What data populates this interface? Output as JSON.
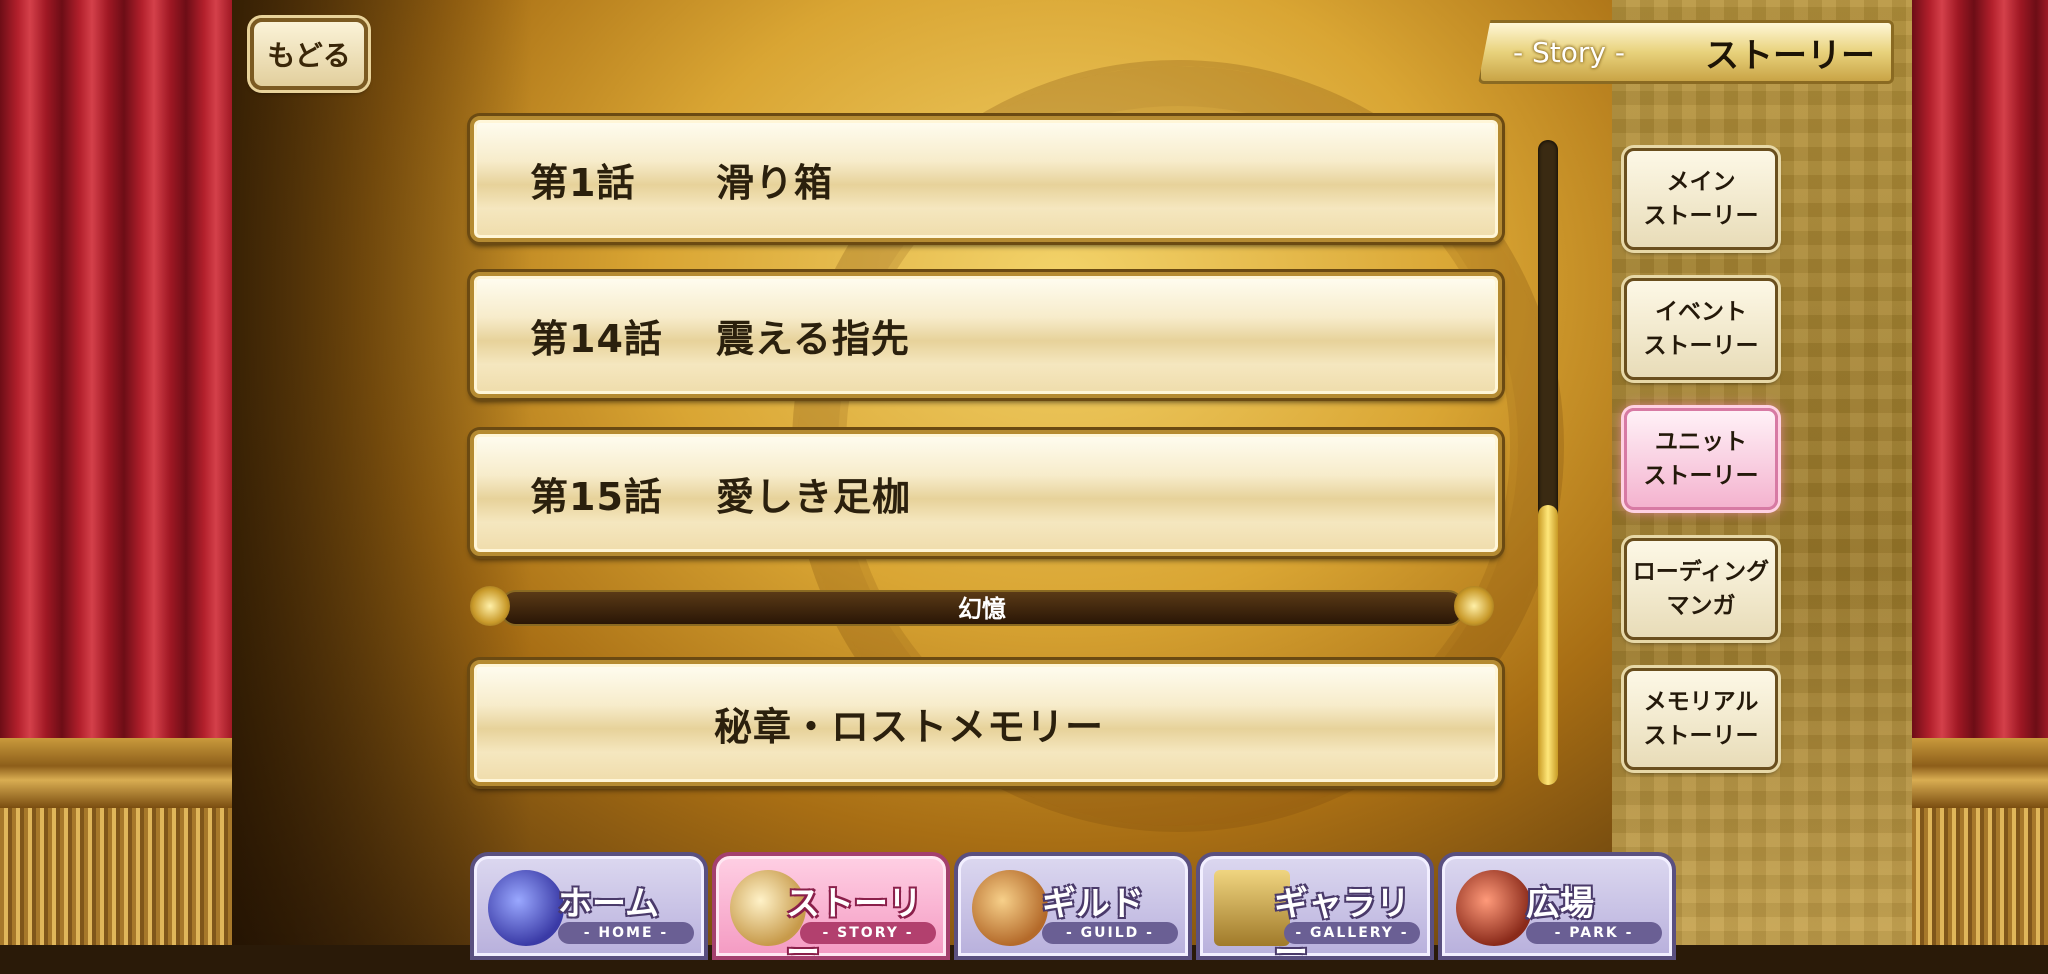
{
  "back_button": {
    "label": "もどる"
  },
  "header": {
    "en": "- Story -",
    "jp": "ストーリー"
  },
  "stories": [
    {
      "num": "第1話",
      "title": "滑り箱"
    },
    {
      "num": "第14話",
      "title": "震える指先"
    },
    {
      "num": "第15話",
      "title": "愛しき足枷"
    }
  ],
  "section": {
    "label": "幻憶"
  },
  "special_story": {
    "title": "秘章・ロストメモリー"
  },
  "categories": [
    {
      "label": "メイン\nストーリー"
    },
    {
      "label": "イベント\nストーリー"
    },
    {
      "label": "ユニット\nストーリー"
    },
    {
      "label": "ローディング\nマンガ"
    },
    {
      "label": "メモリアル\nストーリー"
    }
  ],
  "nav": [
    {
      "label": "ホーム",
      "sub": "- HOME -",
      "icon": "tent-icon"
    },
    {
      "label": "ストーリー",
      "sub": "- STORY -",
      "icon": "scroll-icon"
    },
    {
      "label": "ギルド",
      "sub": "- GUILD -",
      "icon": "castle-icon"
    },
    {
      "label": "ギャラリー",
      "sub": "- GALLERY -",
      "icon": "frames-icon"
    },
    {
      "label": "広場",
      "sub": "- PARK -",
      "icon": "characters-icon"
    }
  ],
  "active_category": "ユニット\nストーリー",
  "active_nav": "ストーリー",
  "scroll_position": 0.58
}
